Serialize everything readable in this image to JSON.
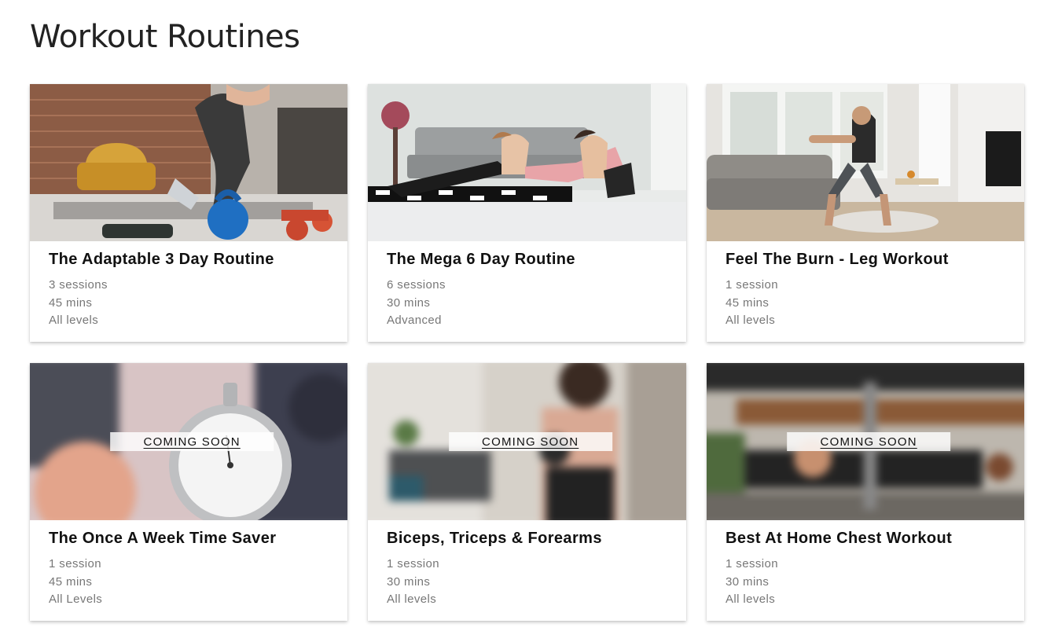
{
  "page": {
    "title": "Workout Routines"
  },
  "colors": {
    "card_bg": "#ffffff",
    "meta_text": "#777777",
    "title_text": "#111111"
  },
  "routines": [
    {
      "title": "The Adaptable 3 Day Routine",
      "sessions": "3 sessions",
      "duration": "45 mins",
      "level": "All levels",
      "badge": "",
      "image": "kettlebell-lunge-photo"
    },
    {
      "title": "The Mega 6 Day Routine",
      "sessions": "6 sessions",
      "duration": "30 mins",
      "level": "Advanced",
      "badge": "",
      "image": "plank-duo-photo"
    },
    {
      "title": "Feel The Burn - Leg Workout",
      "sessions": "1 session",
      "duration": "45 mins",
      "level": "All levels",
      "badge": "",
      "image": "squat-living-room-photo"
    },
    {
      "title": "The Once A Week Time Saver",
      "sessions": "1 session",
      "duration": "45 mins",
      "level": "All Levels",
      "badge": "COMING SOON",
      "image": "stopwatch-photo"
    },
    {
      "title": "Biceps, Triceps & Forearms",
      "sessions": "1 session",
      "duration": "30 mins",
      "level": "All levels",
      "badge": "COMING SOON",
      "image": "dumbbell-curl-photo"
    },
    {
      "title": "Best At Home Chest Workout",
      "sessions": "1 session",
      "duration": "30 mins",
      "level": "All levels",
      "badge": "COMING SOON",
      "image": "bench-press-photo"
    }
  ]
}
